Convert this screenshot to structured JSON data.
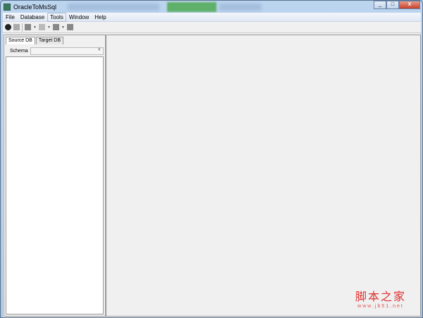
{
  "window": {
    "title": "OracleToMsSql",
    "controls": [
      "_",
      "□",
      "X"
    ]
  },
  "menu": [
    "File",
    "Database",
    "Tools",
    "Window",
    "Help"
  ],
  "toolbar": [
    "connect-icon",
    "disconnect-icon",
    "export-icon",
    "script-icon",
    "table-icon",
    "stop-icon"
  ],
  "left_panel": {
    "tabs": [
      "Source DB",
      "Target DB"
    ],
    "active_tab": "Source DB",
    "schema_label": "Schema",
    "schema_value": ""
  },
  "watermark": {
    "cn": "脚本之家",
    "en": "www.jb51.net"
  }
}
